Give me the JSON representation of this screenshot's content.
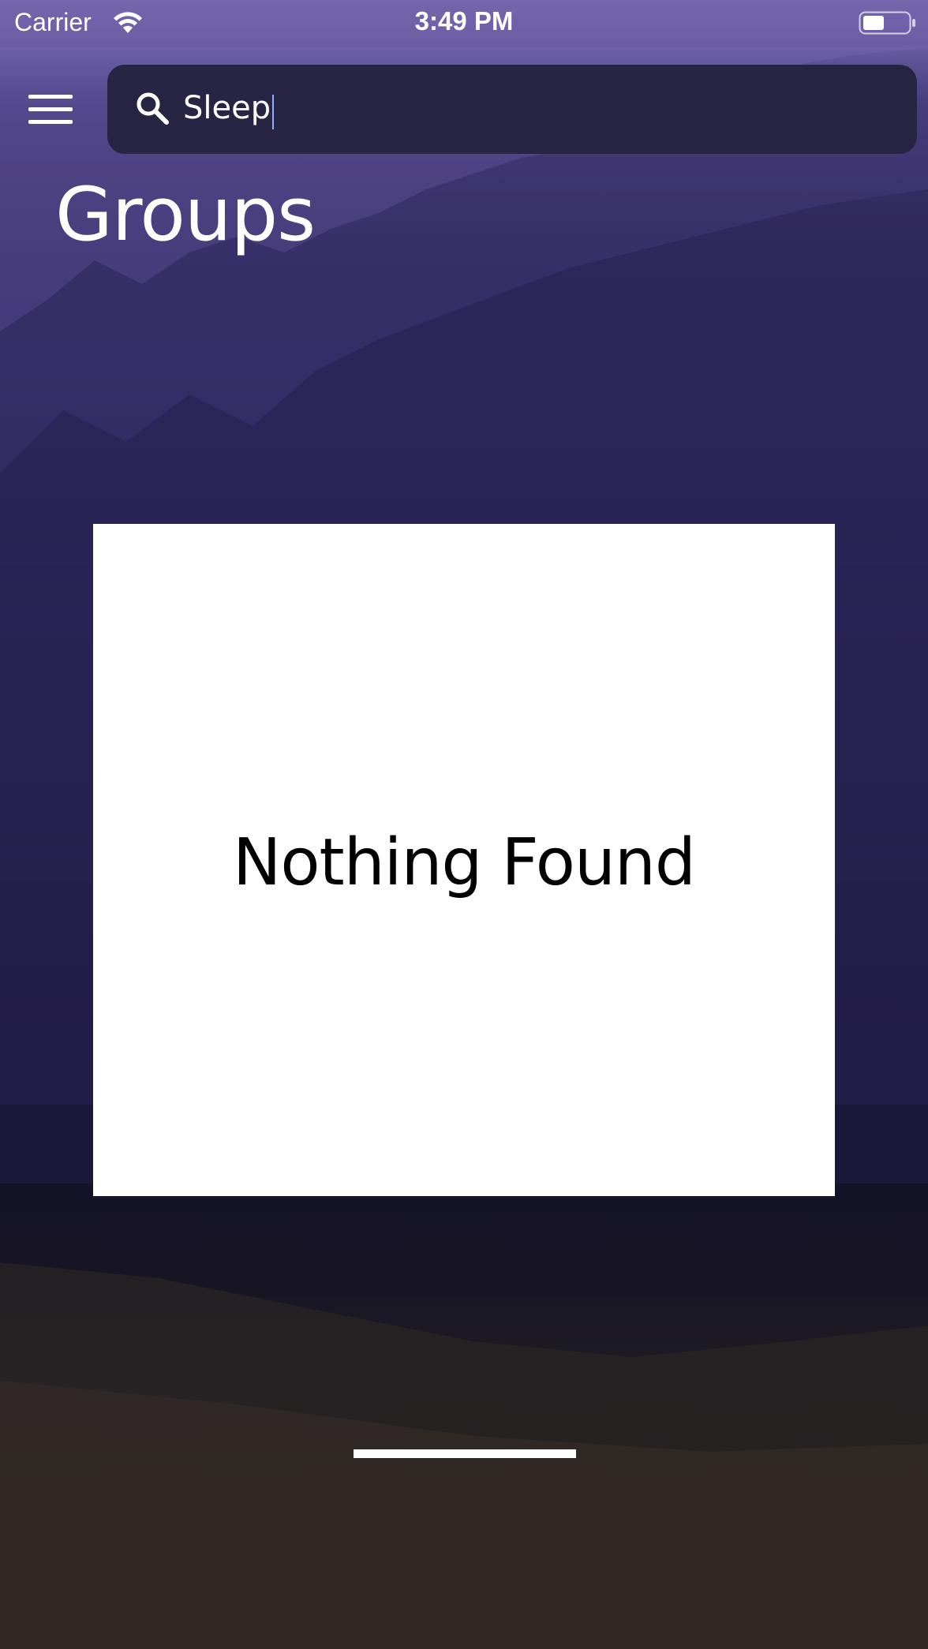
{
  "status_bar": {
    "carrier": "Carrier",
    "time": "3:49 PM",
    "wifi_icon": "wifi-icon",
    "battery_icon": "battery-icon"
  },
  "header": {
    "menu_icon": "hamburger-menu-icon",
    "search": {
      "icon": "search-icon",
      "value": "Sleep"
    }
  },
  "page": {
    "title": "Groups"
  },
  "results": {
    "empty_message": "Nothing Found"
  },
  "colors": {
    "background_top": "#7466ad",
    "background_bottom": "#1e1a1a",
    "search_box": "#272543",
    "card": "#ffffff",
    "caret": "#8ab4ff"
  }
}
